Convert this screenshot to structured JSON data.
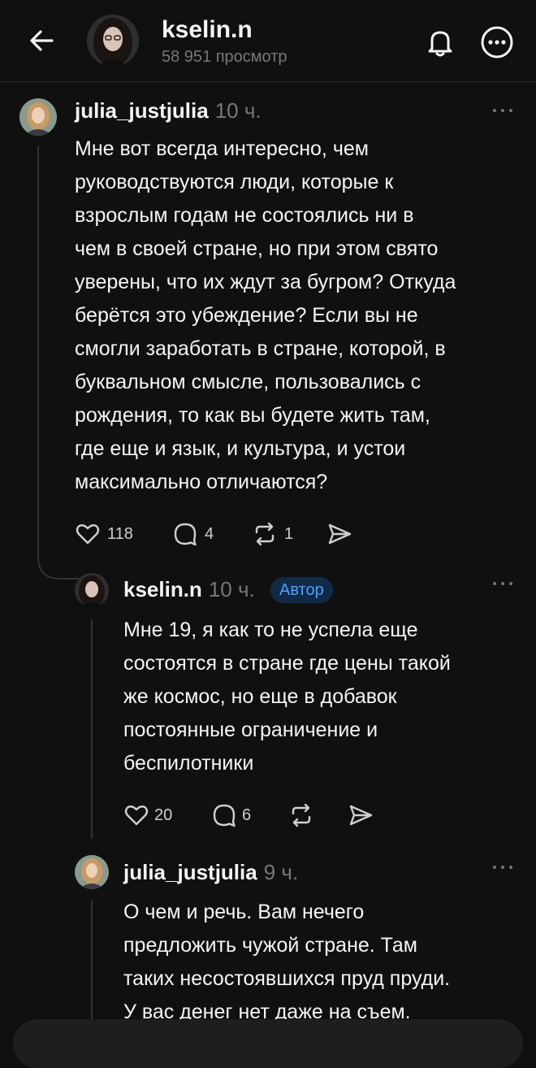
{
  "header": {
    "username": "kselin.n",
    "views": "58 951 просмотр"
  },
  "comments": [
    {
      "username": "julia_justjulia",
      "time": "10 ч.",
      "lines": [
        "Мне вот всегда интересно, чем",
        "руководствуются люди, которые к",
        "взрослым годам не состоялись ни в",
        "чем в своей стране, но при этом свято",
        "уверены, что их ждут за бугром? Откуда",
        "берётся это убеждение? Если вы не",
        "смогли заработать в стране, которой, в",
        "буквальном смысле, пользовались с",
        "рождения, то как вы будете жить там,",
        "где еще и язык,  и культура, и устои",
        "максимально отличаются?"
      ],
      "likes": "118",
      "replies": "4",
      "reposts": "1"
    },
    {
      "username": "kselin.n",
      "time": "10 ч.",
      "badge": "Автор",
      "lines": [
        "Мне 19, я как то не успела еще",
        "состоятся в стране где цены такой",
        "же космос, но еще в добавок",
        "постоянные ограничение и",
        "беспилотники"
      ],
      "likes": "20",
      "replies": "6"
    },
    {
      "username": "julia_justjulia",
      "time": "9 ч.",
      "lines": [
        "О чем и речь. Вам нечего",
        "предложить чужой стране. Там",
        "таких несостоявшихся пруд пруди.",
        "У вас денег нет даже на съем."
      ]
    }
  ]
}
